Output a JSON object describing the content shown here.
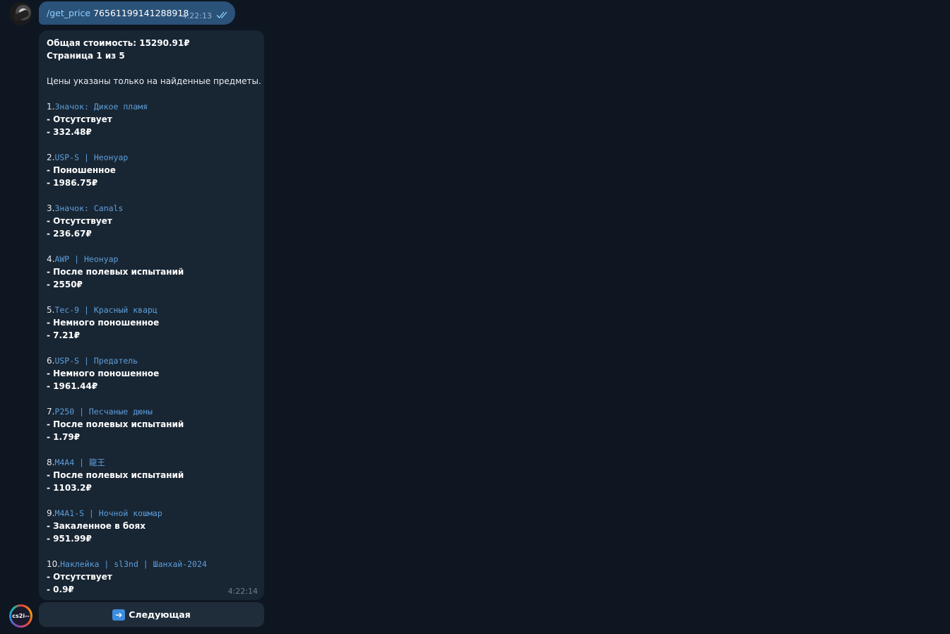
{
  "outgoing": {
    "command": "/get_price",
    "argument": " 76561199141288918",
    "time": "4:22:13"
  },
  "incoming": {
    "total": "Общая стоимость: 15290.91₽",
    "page": "Страница 1 из 5",
    "note": "Цены указаны только на найденные предметы.",
    "time": "4:22:14",
    "items": [
      {
        "num": "1.",
        "name": "Значок: Дикое пламя",
        "condition": "- Отсутствует",
        "price": "- 332.48₽"
      },
      {
        "num": "2.",
        "name": "USP-S | Неонуар",
        "condition": "- Поношенное",
        "price": "- 1986.75₽"
      },
      {
        "num": "3.",
        "name": "Значок: Canals",
        "condition": "- Отсутствует",
        "price": "- 236.67₽"
      },
      {
        "num": "4.",
        "name": "AWP | Неонуар",
        "condition": "- После полевых испытаний",
        "price": "- 2550₽"
      },
      {
        "num": "5.",
        "name": "Tec-9 | Красный кварц",
        "condition": "- Немного поношенное",
        "price": "- 7.21₽"
      },
      {
        "num": "6.",
        "name": "USP-S | Предатель",
        "condition": "- Немного поношенное",
        "price": "- 1961.44₽"
      },
      {
        "num": "7.",
        "name": "P250 | Песчаные дюны",
        "condition": "- После полевых испытаний",
        "price": "- 1.79₽"
      },
      {
        "num": "8.",
        "name": "M4A4 | 龍王",
        "condition": "- После полевых испытаний",
        "price": "- 1103.2₽"
      },
      {
        "num": "9.",
        "name": "M4A1-S | Ночной кошмар",
        "condition": "- Закаленное в боях",
        "price": "- 951.99₽"
      },
      {
        "num": "10.",
        "name": "Наклейка | sl3nd | Шанхай-2024",
        "condition": "- Отсутствует",
        "price": "- 0.9₽"
      }
    ]
  },
  "keyboard": {
    "next_label": "Следующая",
    "next_icon": "arrow-right-icon"
  },
  "bot_avatar": {
    "text": "cs2i--"
  },
  "colors": {
    "background": "#0e1621",
    "outgoing_bubble": "#2b5278",
    "incoming_bubble": "#182533",
    "link": "#5d9fda"
  }
}
